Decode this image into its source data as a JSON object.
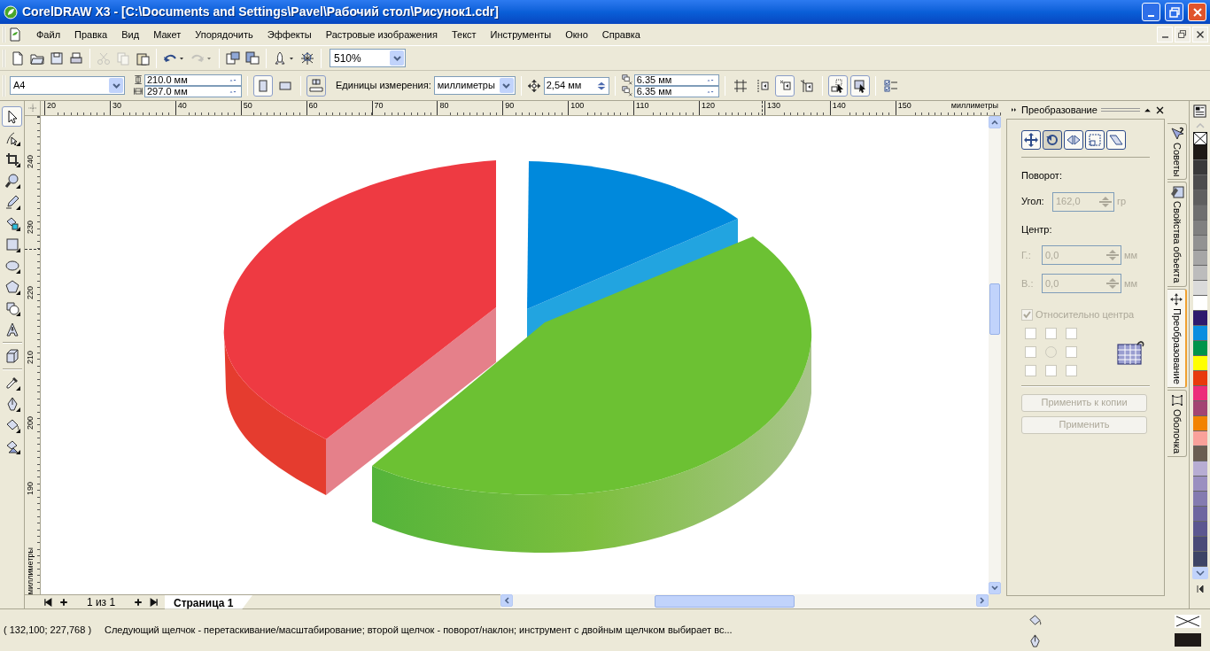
{
  "window": {
    "title": "CorelDRAW X3 - [C:\\Documents and Settings\\Pavel\\Рабочий стол\\Рисунок1.cdr]"
  },
  "menu": [
    "Файл",
    "Правка",
    "Вид",
    "Макет",
    "Упорядочить",
    "Эффекты",
    "Растровые изображения",
    "Текст",
    "Инструменты",
    "Окно",
    "Справка"
  ],
  "toolbar": {
    "buttons": [
      {
        "kind": "new",
        "disabled": false
      },
      {
        "kind": "open",
        "disabled": false
      },
      {
        "kind": "save",
        "disabled": false
      },
      {
        "kind": "print",
        "disabled": false
      },
      {
        "kind": "cut",
        "disabled": true
      },
      {
        "kind": "copy",
        "disabled": true
      },
      {
        "kind": "paste",
        "disabled": false
      },
      {
        "kind": "undo",
        "disabled": false
      },
      {
        "kind": "redo",
        "disabled": true
      },
      {
        "kind": "import",
        "disabled": false
      },
      {
        "kind": "export",
        "disabled": false
      },
      {
        "kind": "launcher",
        "disabled": false
      },
      {
        "kind": "online",
        "disabled": false
      }
    ],
    "zoom": "510%"
  },
  "property_bar": {
    "paper": "A4",
    "width": "210.0 мм",
    "height": "297.0 мм",
    "orientation": [
      {
        "kind": "portrait",
        "selected": true
      },
      {
        "kind": "landscape",
        "selected": false
      }
    ],
    "units_label": "Единицы измерения:",
    "units": "миллиметры",
    "nudge": "2,54 мм",
    "duplicate_x": "6.35 мм",
    "duplicate_y": "6.35 мм",
    "toggles": [
      {
        "kind": "grid",
        "selected": false
      },
      {
        "kind": "guidelines",
        "selected": false
      },
      {
        "kind": "objects",
        "selected": true
      },
      {
        "kind": "dynamic",
        "selected": false
      },
      {
        "kind": "group-select",
        "selected": true
      },
      {
        "kind": "frame-select",
        "selected": true
      },
      {
        "kind": "options",
        "selected": false
      }
    ]
  },
  "toolbox": [
    {
      "kind": "pick",
      "selected": true
    },
    {
      "kind": "shape",
      "selected": false
    },
    {
      "kind": "crop",
      "selected": false
    },
    {
      "kind": "zoom",
      "selected": false
    },
    {
      "kind": "freehand",
      "selected": false
    },
    {
      "kind": "smartfill",
      "selected": false
    },
    {
      "kind": "rectangle",
      "selected": false
    },
    {
      "kind": "ellipse",
      "selected": false
    },
    {
      "kind": "polygon",
      "selected": false
    },
    {
      "kind": "shapes",
      "selected": false
    },
    {
      "kind": "text",
      "selected": false
    },
    {
      "kind": "extrude",
      "selected": false
    },
    {
      "kind": "eyedropper",
      "selected": false
    },
    {
      "kind": "outline",
      "selected": false
    },
    {
      "kind": "fill",
      "selected": false
    },
    {
      "kind": "ifill",
      "selected": false
    }
  ],
  "rulers": {
    "horizontal": {
      "labels": [
        "20",
        "30",
        "40",
        "50",
        "60",
        "70",
        "80",
        "90",
        "100",
        "110",
        "120",
        "130",
        "140",
        "150"
      ],
      "unit": "миллиметры"
    },
    "vertical": {
      "labels": [
        "240",
        "230",
        "220",
        "210",
        "200",
        "190"
      ],
      "unit": "миллиметры"
    }
  },
  "page_nav": {
    "count": "1 из 1",
    "tabs": [
      {
        "label": "Страница 1",
        "selected": true
      }
    ]
  },
  "docker": {
    "title": "Преобразование",
    "modes": [
      {
        "kind": "position",
        "selected": false
      },
      {
        "kind": "rotate",
        "selected": true
      },
      {
        "kind": "scale",
        "selected": false
      },
      {
        "kind": "size",
        "selected": false
      },
      {
        "kind": "skew",
        "selected": false
      }
    ],
    "section": "Поворот:",
    "angle": {
      "label": "Угол:",
      "value": "162,0",
      "unit": "гр",
      "disabled": true
    },
    "center_label": "Центр:",
    "center": [
      {
        "label": "Г.:",
        "value": "0,0",
        "unit": "мм",
        "disabled": true
      },
      {
        "label": "В.:",
        "value": "0,0",
        "unit": "мм",
        "disabled": true
      }
    ],
    "relative": {
      "label": "Относительно центра",
      "checked": true,
      "disabled": true
    },
    "buttons": [
      {
        "label": "Применить к копии",
        "disabled": true
      },
      {
        "label": "Применить",
        "disabled": true
      }
    ]
  },
  "docker_tabs": [
    {
      "label": "Советы",
      "selected": false
    },
    {
      "label": "Свойства объекта",
      "selected": false
    },
    {
      "label": "Преобразование",
      "selected": true
    },
    {
      "label": "Оболочка",
      "selected": false
    }
  ],
  "palette": [
    {
      "color": "#1f1a17"
    },
    {
      "color": "#3a3a3a"
    },
    {
      "color": "#4d4d4d"
    },
    {
      "color": "#5f5f5f"
    },
    {
      "color": "#6f6f6f"
    },
    {
      "color": "#808080"
    },
    {
      "color": "#929292"
    },
    {
      "color": "#a6a6a6"
    },
    {
      "color": "#bcbcbc"
    },
    {
      "color": "#dadada"
    },
    {
      "color": "#ffffff"
    },
    {
      "color": "#2e1a6e"
    },
    {
      "color": "#0a8ee0"
    },
    {
      "color": "#00944a"
    },
    {
      "color": "#ffff00"
    },
    {
      "color": "#e83a0c"
    },
    {
      "color": "#ec2c7a"
    },
    {
      "color": "#a34472"
    },
    {
      "color": "#f28300"
    },
    {
      "color": "#f9a19a"
    },
    {
      "color": "#6b5e52"
    },
    {
      "color": "#b7add3"
    },
    {
      "color": "#9a8fc0"
    },
    {
      "color": "#847bb0"
    },
    {
      "color": "#6e66a0"
    },
    {
      "color": "#5c5790"
    },
    {
      "color": "#4a4a78"
    },
    {
      "color": "#3d4466"
    }
  ],
  "status_bar": {
    "coordinates": "( 132,100; 227,768 )",
    "message": "Следующий щелчок - перетаскивание/масштабирование; второй щелчок - поворот/наклон; инструмент с двойным щелчком выбирает вс..."
  }
}
